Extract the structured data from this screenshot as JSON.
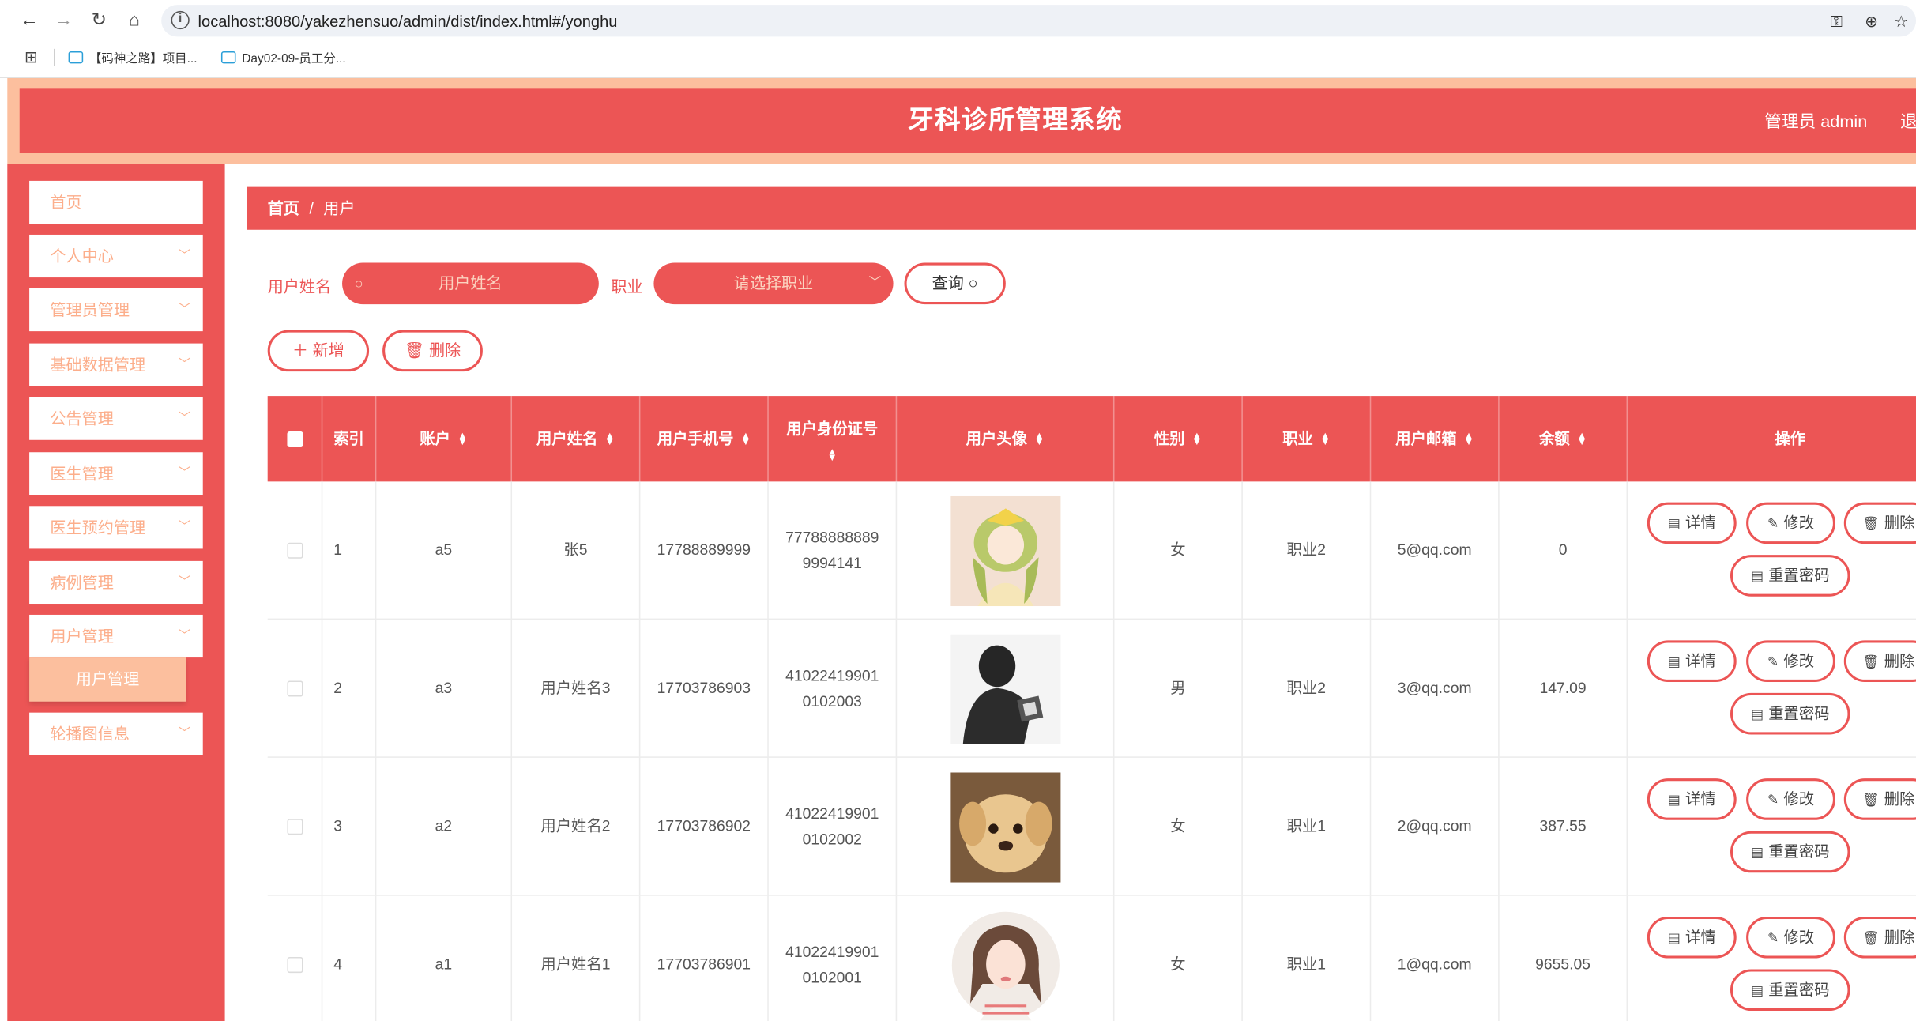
{
  "browser": {
    "url": "localhost:8080/yakezhensuo/admin/dist/index.html#/yonghu",
    "bookmarks": [
      "【码神之路】项目...",
      "Day02-09-员工分..."
    ]
  },
  "header": {
    "title": "牙科诊所管理系统",
    "admin": "管理员 admin",
    "logout": "退出"
  },
  "sidebar": {
    "items": [
      {
        "label": "首页"
      },
      {
        "label": "个人中心"
      },
      {
        "label": "管理员管理"
      },
      {
        "label": "基础数据管理"
      },
      {
        "label": "公告管理"
      },
      {
        "label": "医生管理"
      },
      {
        "label": "医生预约管理"
      },
      {
        "label": "病例管理"
      },
      {
        "label": "用户管理"
      },
      {
        "label": "轮播图信息"
      }
    ],
    "active_sub": "用户管理"
  },
  "breadcrumb": {
    "home": "首页",
    "sep": "/",
    "current": "用户"
  },
  "search": {
    "name_label": "用户姓名",
    "name_placeholder": "用户姓名",
    "job_label": "职业",
    "job_placeholder": "请选择职业",
    "query_label": "查询"
  },
  "toolbar": {
    "add_label": "新增",
    "delete_label": "删除"
  },
  "table": {
    "headers": {
      "index": "索引",
      "account": "账户",
      "name": "用户姓名",
      "phone": "用户手机号",
      "idcard": "用户身份证号",
      "avatar": "用户头像",
      "gender": "性别",
      "job": "职业",
      "email": "用户邮箱",
      "balance": "余额",
      "actions": "操作"
    },
    "action_labels": {
      "detail": "详情",
      "edit": "修改",
      "delete": "删除",
      "reset": "重置密码"
    },
    "rows": [
      {
        "index": "1",
        "account": "a5",
        "name": "张5",
        "phone": "17788889999",
        "idcard1": "77788888889",
        "idcard2": "9994141",
        "gender": "女",
        "job": "职业2",
        "email": "5@qq.com",
        "balance": "0"
      },
      {
        "index": "2",
        "account": "a3",
        "name": "用户姓名3",
        "phone": "17703786903",
        "idcard1": "41022419901",
        "idcard2": "0102003",
        "gender": "男",
        "job": "职业2",
        "email": "3@qq.com",
        "balance": "147.09"
      },
      {
        "index": "3",
        "account": "a2",
        "name": "用户姓名2",
        "phone": "17703786902",
        "idcard1": "41022419901",
        "idcard2": "0102002",
        "gender": "女",
        "job": "职业1",
        "email": "2@qq.com",
        "balance": "387.55"
      },
      {
        "index": "4",
        "account": "a1",
        "name": "用户姓名1",
        "phone": "17703786901",
        "idcard1": "41022419901",
        "idcard2": "0102001",
        "gender": "女",
        "job": "职业1",
        "email": "1@qq.com",
        "balance": "9655.05"
      }
    ]
  }
}
